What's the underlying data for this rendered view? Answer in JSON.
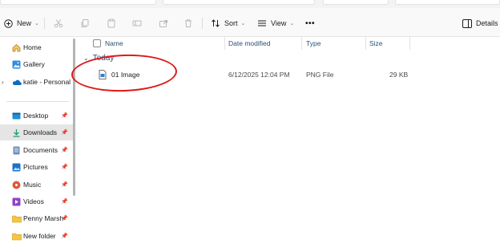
{
  "toolbar": {
    "new_label": "New",
    "sort_label": "Sort",
    "view_label": "View",
    "more_label": "•••",
    "details_label": "Details"
  },
  "sidebar": {
    "items": [
      {
        "label": "Home",
        "icon": "home-icon"
      },
      {
        "label": "Gallery",
        "icon": "gallery-icon"
      },
      {
        "label": "katie - Personal",
        "icon": "onedrive-cloud-icon"
      },
      {
        "label": "Desktop",
        "icon": "desktop-icon",
        "pinned": true
      },
      {
        "label": "Downloads",
        "icon": "download-icon",
        "pinned": true,
        "selected": true
      },
      {
        "label": "Documents",
        "icon": "documents-icon",
        "pinned": true
      },
      {
        "label": "Pictures",
        "icon": "pictures-icon",
        "pinned": true
      },
      {
        "label": "Music",
        "icon": "music-icon",
        "pinned": true
      },
      {
        "label": "Videos",
        "icon": "videos-icon",
        "pinned": true
      },
      {
        "label": "Penny Marsh",
        "icon": "folder-icon",
        "pinned": true
      },
      {
        "label": "New folder",
        "icon": "folder-icon",
        "pinned": true
      }
    ]
  },
  "columns": {
    "name": "Name",
    "date_modified": "Date modified",
    "type": "Type",
    "size": "Size"
  },
  "group": {
    "label": "Today"
  },
  "files": [
    {
      "name": "01 Image",
      "date_modified": "6/12/2025 12:04 PM",
      "type": "PNG File",
      "size": "29 KB"
    }
  ],
  "colors": {
    "accent": "#0067c0",
    "header_text": "#2b4f7a",
    "annotation": "#e01818",
    "selection": "#e5e5e5"
  }
}
